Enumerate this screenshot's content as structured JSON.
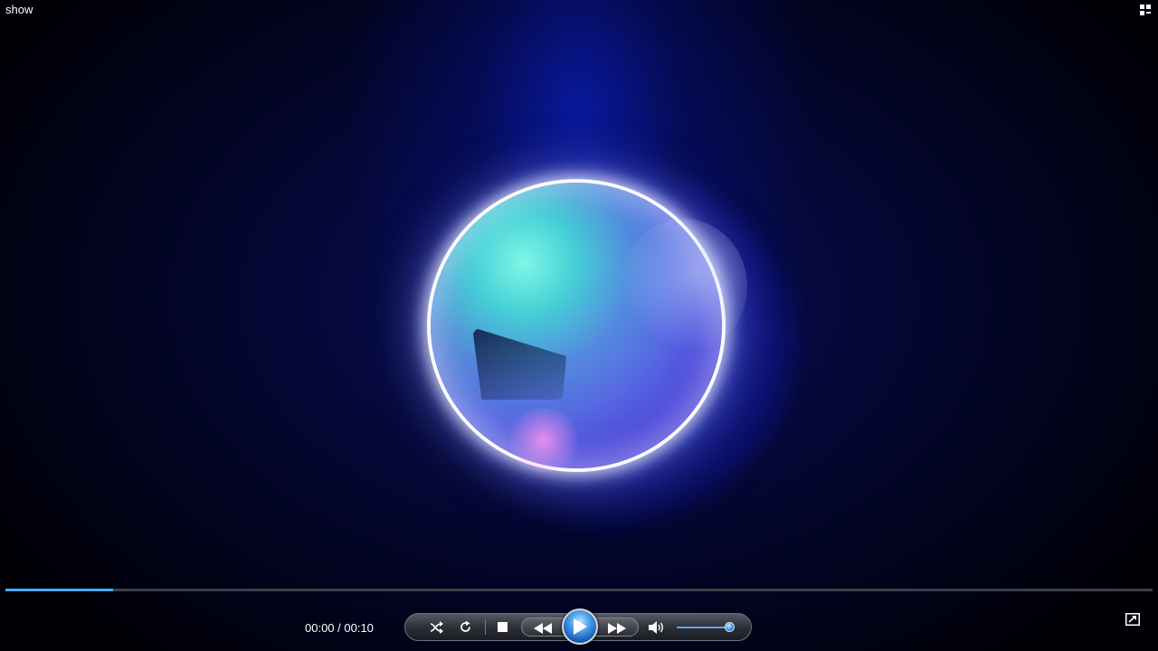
{
  "window": {
    "title": "show"
  },
  "player": {
    "time_display": "00:00 / 00:10",
    "seek_progress": 0.094,
    "volume_level": 0.92
  },
  "controls": {
    "buttons": [
      "shuffle-icon",
      "repeat-icon",
      "stop-icon",
      "previous-icon",
      "play-icon",
      "next-icon",
      "volume-icon"
    ],
    "accent_color": "#4aa8ff"
  },
  "icons": {
    "layout": "switch-layout-icon",
    "mini_mode": "switch-to-now-playing-icon"
  }
}
